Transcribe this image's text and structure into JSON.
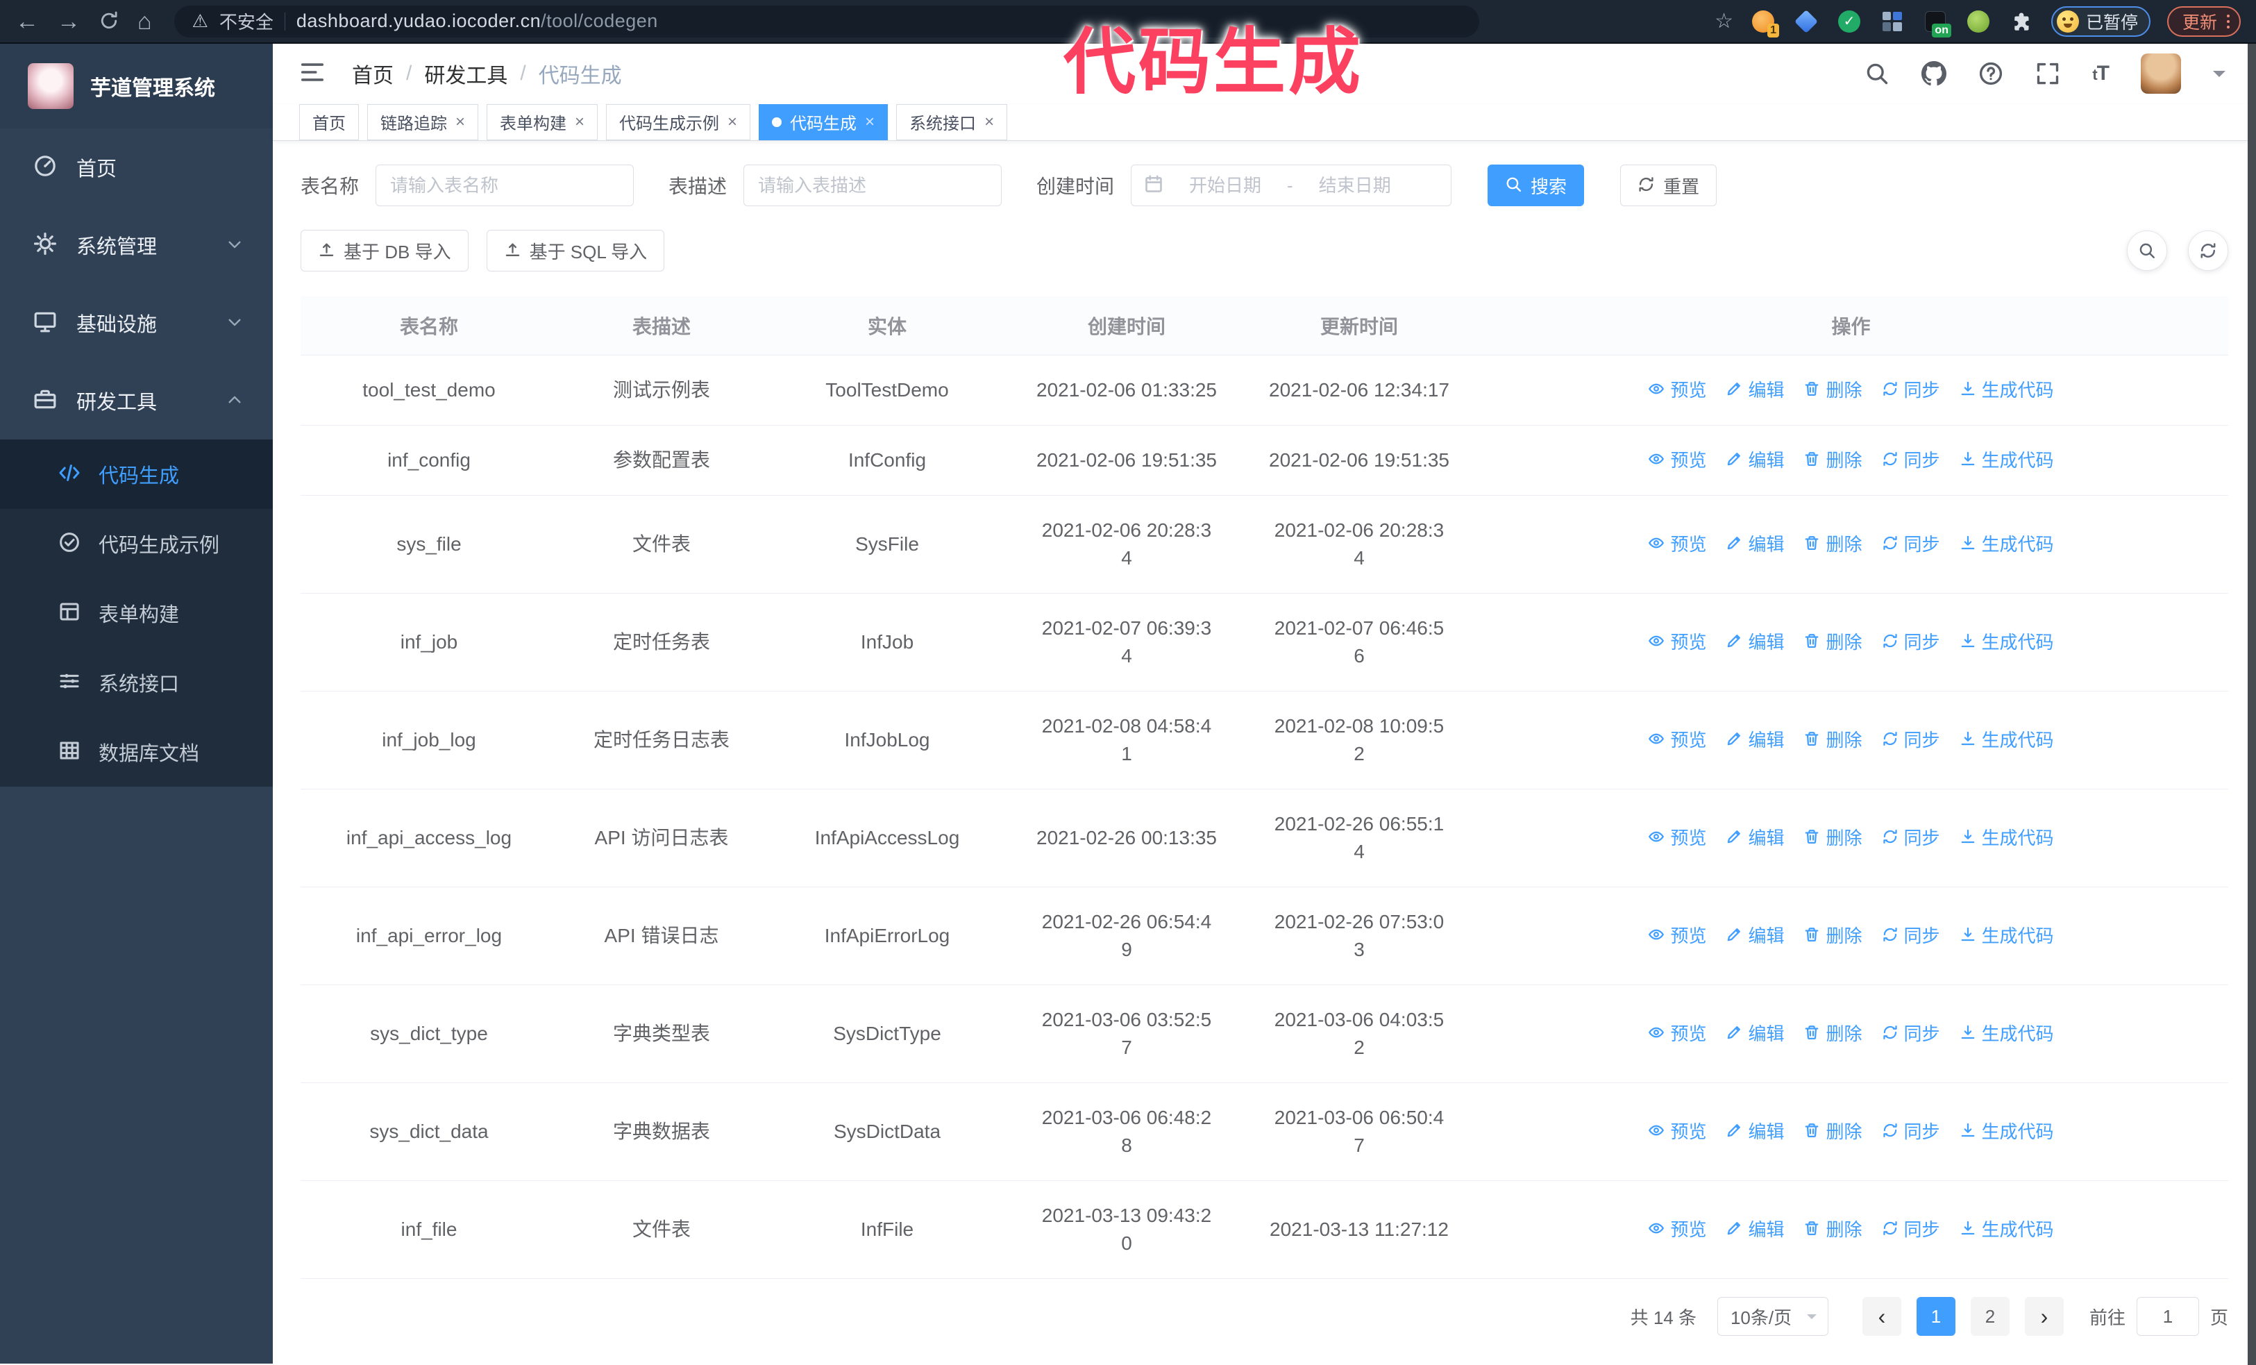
{
  "browser": {
    "security_label": "不安全",
    "url_domain": "dashboard.yudao.iocoder.cn",
    "url_path": "/tool/codegen",
    "extension_count_badge": "1",
    "extension_on_badge": "on",
    "profile_badge": "已暂停",
    "update_label": "更新"
  },
  "annotation": {
    "text": "代码生成",
    "color": "#fb4060"
  },
  "sidebar": {
    "logo_title": "芋道管理系统",
    "items": [
      {
        "key": "home",
        "label": "首页",
        "icon": "dashboard-icon",
        "chevron": "none"
      },
      {
        "key": "system",
        "label": "系统管理",
        "icon": "gear-icon",
        "chevron": "down"
      },
      {
        "key": "infra",
        "label": "基础设施",
        "icon": "monitor-icon",
        "chevron": "down"
      },
      {
        "key": "devtools",
        "label": "研发工具",
        "icon": "toolbox-icon",
        "chevron": "up"
      }
    ],
    "submenu": [
      {
        "key": "codegen",
        "label": "代码生成",
        "icon": "code-icon",
        "active": true
      },
      {
        "key": "codegen-example",
        "label": "代码生成示例",
        "icon": "check-circle-icon",
        "active": false
      },
      {
        "key": "form-builder",
        "label": "表单构建",
        "icon": "form-icon",
        "active": false
      },
      {
        "key": "system-api",
        "label": "系统接口",
        "icon": "api-icon",
        "active": false
      },
      {
        "key": "db-doc",
        "label": "数据库文档",
        "icon": "database-icon",
        "active": false
      }
    ]
  },
  "breadcrumb": {
    "items": [
      "首页",
      "研发工具",
      "代码生成"
    ],
    "separator": "/"
  },
  "tabs": [
    {
      "key": "home",
      "label": "首页",
      "closable": false,
      "active": false
    },
    {
      "key": "tracing",
      "label": "链路追踪",
      "closable": true,
      "active": false
    },
    {
      "key": "form-builder",
      "label": "表单构建",
      "closable": true,
      "active": false
    },
    {
      "key": "codegen-example",
      "label": "代码生成示例",
      "closable": true,
      "active": false
    },
    {
      "key": "codegen",
      "label": "代码生成",
      "closable": true,
      "active": true
    },
    {
      "key": "system-api",
      "label": "系统接口",
      "closable": true,
      "active": false
    }
  ],
  "filters": {
    "table_name": {
      "label": "表名称",
      "placeholder": "请输入表名称",
      "value": ""
    },
    "table_desc": {
      "label": "表描述",
      "placeholder": "请输入表描述",
      "value": ""
    },
    "create_time": {
      "label": "创建时间",
      "start_placeholder": "开始日期",
      "separator": "-",
      "end_placeholder": "结束日期"
    },
    "search_label": "搜索",
    "reset_label": "重置"
  },
  "toolbar": {
    "import_db_label": "基于 DB 导入",
    "import_sql_label": "基于 SQL 导入"
  },
  "table": {
    "columns": [
      "表名称",
      "表描述",
      "实体",
      "创建时间",
      "更新时间",
      "操作"
    ],
    "actions": [
      {
        "key": "preview",
        "label": "预览",
        "icon": "eye-icon"
      },
      {
        "key": "edit",
        "label": "编辑",
        "icon": "edit-icon"
      },
      {
        "key": "delete",
        "label": "删除",
        "icon": "trash-icon"
      },
      {
        "key": "sync",
        "label": "同步",
        "icon": "sync-icon"
      },
      {
        "key": "generate-code",
        "label": "生成代码",
        "icon": "download-icon"
      }
    ],
    "rows": [
      {
        "name": "tool_test_demo",
        "desc": "测试示例表",
        "entity": "ToolTestDemo",
        "created": "2021-02-06 01:33:25",
        "updated": "2021-02-06 12:34:17"
      },
      {
        "name": "inf_config",
        "desc": "参数配置表",
        "entity": "InfConfig",
        "created": "2021-02-06 19:51:35",
        "updated": "2021-02-06 19:51:35"
      },
      {
        "name": "sys_file",
        "desc": "文件表",
        "entity": "SysFile",
        "created": "2021-02-06 20:28:3\n4",
        "updated": "2021-02-06 20:28:3\n4"
      },
      {
        "name": "inf_job",
        "desc": "定时任务表",
        "entity": "InfJob",
        "created": "2021-02-07 06:39:3\n4",
        "updated": "2021-02-07 06:46:5\n6"
      },
      {
        "name": "inf_job_log",
        "desc": "定时任务日志表",
        "entity": "InfJobLog",
        "created": "2021-02-08 04:58:4\n1",
        "updated": "2021-02-08 10:09:5\n2"
      },
      {
        "name": "inf_api_access_log",
        "desc": "API 访问日志表",
        "entity": "InfApiAccessLog",
        "created": "2021-02-26 00:13:35",
        "updated": "2021-02-26 06:55:1\n4"
      },
      {
        "name": "inf_api_error_log",
        "desc": "API 错误日志",
        "entity": "InfApiErrorLog",
        "created": "2021-02-26 06:54:4\n9",
        "updated": "2021-02-26 07:53:0\n3"
      },
      {
        "name": "sys_dict_type",
        "desc": "字典类型表",
        "entity": "SysDictType",
        "created": "2021-03-06 03:52:5\n7",
        "updated": "2021-03-06 04:03:5\n2"
      },
      {
        "name": "sys_dict_data",
        "desc": "字典数据表",
        "entity": "SysDictData",
        "created": "2021-03-06 06:48:2\n8",
        "updated": "2021-03-06 06:50:4\n7"
      },
      {
        "name": "inf_file",
        "desc": "文件表",
        "entity": "InfFile",
        "created": "2021-03-13 09:43:2\n0",
        "updated": "2021-03-13 11:27:12"
      }
    ]
  },
  "pagination": {
    "total_label": "共 14 条",
    "page_size_label": "10条/页",
    "pages": [
      "1",
      "2"
    ],
    "active_page": "1",
    "goto_label": "前往",
    "goto_value": "1",
    "page_unit_label": "页"
  },
  "colors": {
    "primary": "#409EFF",
    "sidebar_bg": "#304156",
    "submenu_bg": "#1F2D3D",
    "annotation": "#FB4060",
    "table_border": "#EBEEF5",
    "header_text": "#909399"
  }
}
